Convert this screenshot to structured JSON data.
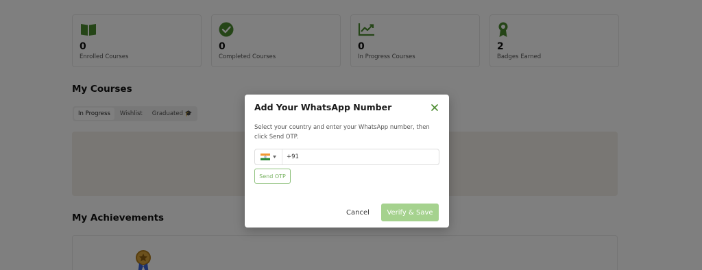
{
  "stats": [
    {
      "icon": "book-icon",
      "value": "0",
      "label": "Enrolled Courses"
    },
    {
      "icon": "check-circle-icon",
      "value": "0",
      "label": "Completed Courses"
    },
    {
      "icon": "chart-icon",
      "value": "0",
      "label": "In Progress Courses"
    },
    {
      "icon": "badge-icon",
      "value": "2",
      "label": "Badges Earned"
    }
  ],
  "courses": {
    "title": "My Courses",
    "tabs": [
      {
        "label": "In Progress",
        "active": true
      },
      {
        "label": "Wishlist",
        "active": false
      },
      {
        "label": "Graduated 🎓",
        "active": false
      }
    ]
  },
  "achievements": {
    "title": "My Achievements"
  },
  "modal": {
    "title": "Add Your WhatsApp Number",
    "description": "Select your country and enter your WhatsApp number, then click Send OTP.",
    "country_flag": "india-flag-icon",
    "phone_value": "+91",
    "send_otp_label": "Send OTP",
    "cancel_label": "Cancel",
    "verify_label": "Verify & Save"
  },
  "colors": {
    "accent": "#4a8a2e",
    "verify_button": "#a5d28e",
    "send_otp_border": "#8cc07a"
  }
}
